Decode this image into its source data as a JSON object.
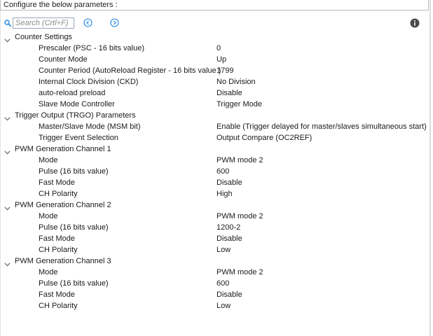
{
  "header": {
    "title": "Configure the below parameters :"
  },
  "toolbar": {
    "search_placeholder": "Search (Crtl+F)",
    "search_value": "",
    "icons": [
      "search-icon",
      "previous-arrow-icon",
      "next-arrow-icon",
      "info-icon"
    ],
    "accent_color": "#1e88e5"
  },
  "groups": [
    {
      "label": "Counter Settings",
      "expanded": true,
      "params": [
        {
          "name": "Prescaler (PSC - 16 bits value)",
          "value": "0"
        },
        {
          "name": "Counter Mode",
          "value": "Up"
        },
        {
          "name": "Counter Period (AutoReload Register - 16 bits value )",
          "value": "1799"
        },
        {
          "name": "Internal Clock Division (CKD)",
          "value": "No Division"
        },
        {
          "name": "auto-reload preload",
          "value": "Disable"
        },
        {
          "name": "Slave Mode Controller",
          "value": "Trigger Mode"
        }
      ]
    },
    {
      "label": "Trigger Output (TRGO) Parameters",
      "expanded": true,
      "params": [
        {
          "name": "Master/Slave Mode (MSM bit)",
          "value": "Enable (Trigger delayed for master/slaves simultaneous start)"
        },
        {
          "name": "Trigger Event Selection",
          "value": "Output Compare (OC2REF)"
        }
      ]
    },
    {
      "label": "PWM Generation Channel 1",
      "expanded": true,
      "params": [
        {
          "name": "Mode",
          "value": "PWM mode 2"
        },
        {
          "name": "Pulse (16 bits value)",
          "value": "600"
        },
        {
          "name": "Fast Mode",
          "value": "Disable"
        },
        {
          "name": "CH Polarity",
          "value": "High"
        }
      ]
    },
    {
      "label": "PWM Generation Channel 2",
      "expanded": true,
      "params": [
        {
          "name": "Mode",
          "value": "PWM mode 2"
        },
        {
          "name": "Pulse (16 bits value)",
          "value": "1200-2"
        },
        {
          "name": "Fast Mode",
          "value": "Disable"
        },
        {
          "name": "CH Polarity",
          "value": "Low"
        }
      ]
    },
    {
      "label": "PWM Generation Channel 3",
      "expanded": true,
      "params": [
        {
          "name": "Mode",
          "value": "PWM mode 2"
        },
        {
          "name": "Pulse (16 bits value)",
          "value": "600"
        },
        {
          "name": "Fast Mode",
          "value": "Disable"
        },
        {
          "name": "CH Polarity",
          "value": "Low"
        }
      ]
    }
  ]
}
